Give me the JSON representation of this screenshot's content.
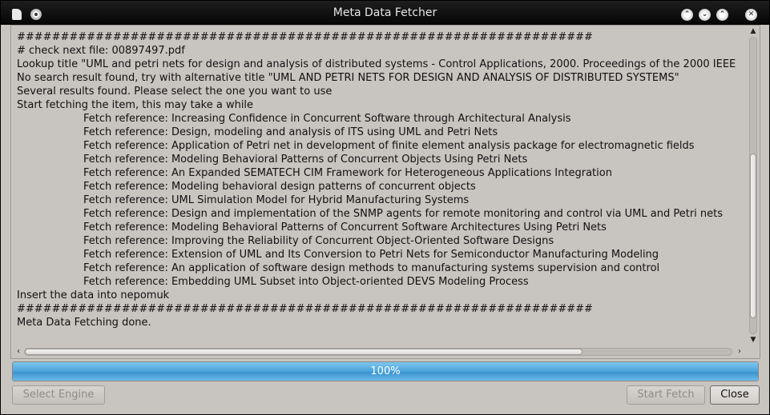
{
  "window": {
    "title": "Meta Data Fetcher",
    "titlebar_buttons": [
      "keep-above-icon",
      "minimize-icon",
      "maximize-icon",
      "close-icon"
    ]
  },
  "log": {
    "lines": [
      {
        "text": "",
        "indent": false
      },
      {
        "text": "##################################################################",
        "indent": false
      },
      {
        "text": "# check next file: 00897497.pdf",
        "indent": false
      },
      {
        "text": "Lookup title \"UML and petri nets for design and analysis of distributed systems - Control Applications, 2000. Proceedings of the 2000 IEEE",
        "indent": false
      },
      {
        "text": "No search result found, try with alternative title \"UML AND PETRI NETS FOR DESIGN AND ANALYSIS OF DISTRIBUTED SYSTEMS\"",
        "indent": false
      },
      {
        "text": "Several results found. Please select the one you want to use",
        "indent": false
      },
      {
        "text": "Start fetching the item, this may take a while",
        "indent": false
      },
      {
        "text": "Fetch reference: Increasing Confidence in Concurrent Software through Architectural Analysis",
        "indent": true
      },
      {
        "text": "Fetch reference: Design, modeling and analysis of ITS using UML and Petri Nets",
        "indent": true
      },
      {
        "text": "Fetch reference: Application of Petri net in development of finite element analysis package for electromagnetic fields",
        "indent": true
      },
      {
        "text": "Fetch reference: Modeling Behavioral Patterns of Concurrent Objects Using Petri Nets",
        "indent": true
      },
      {
        "text": "Fetch reference: An Expanded SEMATECH CIM Framework for Heterogeneous Applications Integration",
        "indent": true
      },
      {
        "text": "Fetch reference: Modeling behavioral design patterns of concurrent objects",
        "indent": true
      },
      {
        "text": "Fetch reference: UML Simulation Model for Hybrid Manufacturing Systems",
        "indent": true
      },
      {
        "text": "Fetch reference: Design and implementation of the SNMP agents for remote monitoring and control via UML and Petri nets",
        "indent": true
      },
      {
        "text": "Fetch reference: Modeling Behavioral Patterns of Concurrent Software Architectures Using Petri Nets",
        "indent": true
      },
      {
        "text": "Fetch reference: Improving the Reliability of Concurrent Object-Oriented Software Designs",
        "indent": true
      },
      {
        "text": "Fetch reference: Extension of UML and Its Conversion to Petri Nets for Semiconductor Manufacturing Modeling",
        "indent": true
      },
      {
        "text": "Fetch reference: An application of software design methods to manufacturing systems supervision and control",
        "indent": true
      },
      {
        "text": "Fetch reference: Embedding UML Subset into Object-oriented DEVS Modeling Process",
        "indent": true
      },
      {
        "text": "Insert the data into nepomuk",
        "indent": false
      },
      {
        "text": "##################################################################",
        "indent": false
      },
      {
        "text": "Meta Data Fetching done.",
        "indent": false
      }
    ]
  },
  "progress": {
    "value_percent": 100,
    "label": "100%"
  },
  "buttons": {
    "select_engine": "Select Engine",
    "start_fetch": "Start Fetch",
    "close": "Close"
  },
  "colors": {
    "accent": "#4aa3dc",
    "window_bg": "#c8c4c0"
  }
}
